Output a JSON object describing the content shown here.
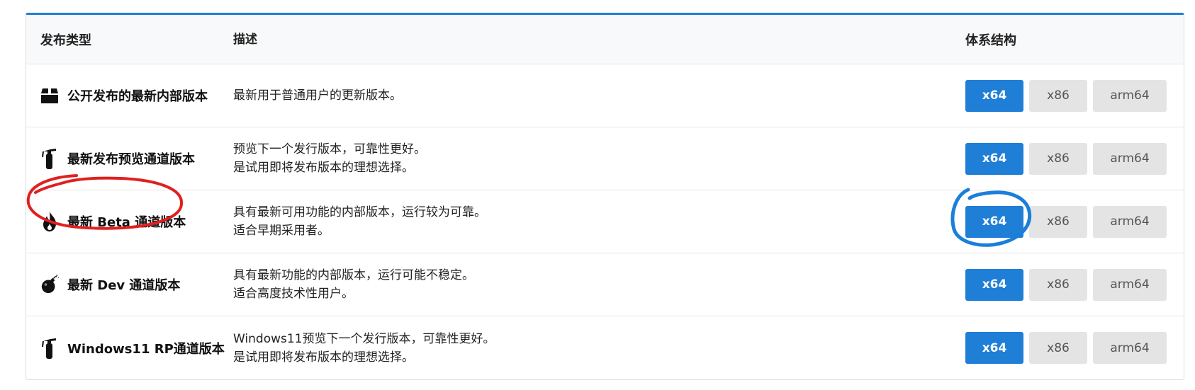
{
  "header": {
    "type": "发布类型",
    "desc": "描述",
    "arch": "体系结构"
  },
  "rows": [
    {
      "icon": "package-icon",
      "label": "公开发布的最新内部版本",
      "desc": [
        "最新用于普通用户的更新版本。"
      ],
      "buttons": [
        "x64",
        "x86",
        "arm64"
      ]
    },
    {
      "icon": "fire-extinguisher-icon",
      "label": "最新发布预览通道版本",
      "desc": [
        "预览下一个发行版本，可靠性更好。",
        "是试用即将发布版本的理想选择。"
      ],
      "buttons": [
        "x64",
        "x86",
        "arm64"
      ]
    },
    {
      "icon": "fire-icon",
      "label": "最新 Beta 通道版本",
      "desc": [
        "具有最新可用功能的内部版本，运行较为可靠。",
        "适合早期采用者。"
      ],
      "buttons": [
        "x64",
        "x86",
        "arm64"
      ]
    },
    {
      "icon": "bomb-icon",
      "label": "最新 Dev 通道版本",
      "desc": [
        "具有最新功能的内部版本，运行可能不稳定。",
        "适合高度技术性用户。"
      ],
      "buttons": [
        "x64",
        "x86",
        "arm64"
      ]
    },
    {
      "icon": "fire-extinguisher-icon",
      "label": "Windows11 RP通道版本",
      "desc": [
        "Windows11预览下一个发行版本，可靠性更好。",
        "是试用即将发布版本的理想选择。"
      ],
      "buttons": [
        "x64",
        "x86",
        "arm64"
      ]
    }
  ],
  "colors": {
    "primary": "#1f7ed6",
    "secondary": "#e4e4e4",
    "red_annotation": "#e02020",
    "blue_annotation": "#1a7fd9"
  }
}
